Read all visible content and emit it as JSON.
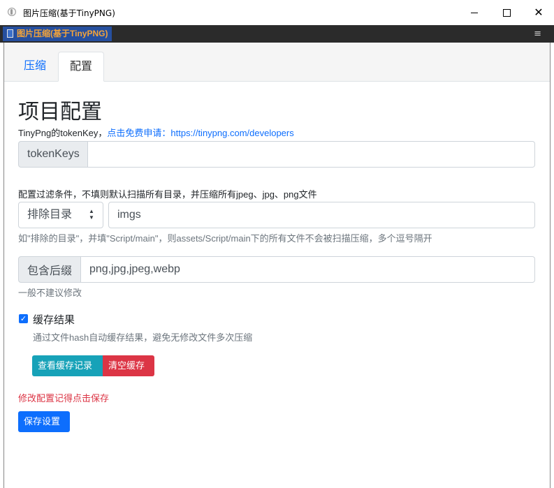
{
  "window": {
    "title": "图片压缩(基于TinyPNG)",
    "minimize": "─",
    "maximize": "☐",
    "close": "✕"
  },
  "strip": {
    "tab_label": "图片压缩(基于TinyPNG)",
    "menu": "≡"
  },
  "tabs": [
    {
      "label": "压缩",
      "active": false
    },
    {
      "label": "配置",
      "active": true
    }
  ],
  "page": {
    "title": "项目配置",
    "token_note_prefix": "TinyPng的tokenKey，",
    "token_note_link": "点击免费申请：https://tinypng.com/developers",
    "token_label": "tokenKeys",
    "token_value": "",
    "filter_label": "配置过滤条件，不填则默认扫描所有目录，并压缩所有jpeg、jpg、png文件",
    "filter_select": "排除目录",
    "filter_value": "imgs",
    "filter_help": "如\"排除的目录\"，并填\"Script/main\"，则assets/Script/main下的所有文件不会被扫描压缩，多个逗号隔开",
    "suffix_label": "包含后缀",
    "suffix_value": "png,jpg,jpeg,webp",
    "suffix_help": "一般不建议修改",
    "cache_checked": true,
    "cache_label": "缓存结果",
    "cache_help": "通过文件hash自动缓存结果，避免无修改文件多次压缩",
    "view_cache_button": "查看缓存记录",
    "clear_cache_button": "清空缓存",
    "warning": "修改配置记得点击保存",
    "save_button": "保存设置"
  },
  "colors": {
    "primary": "#0d6efd",
    "info": "#17a2b8",
    "danger": "#dc3545",
    "strip_tab_text": "#f4a43a",
    "strip_tab_bg": "#264f9e"
  }
}
